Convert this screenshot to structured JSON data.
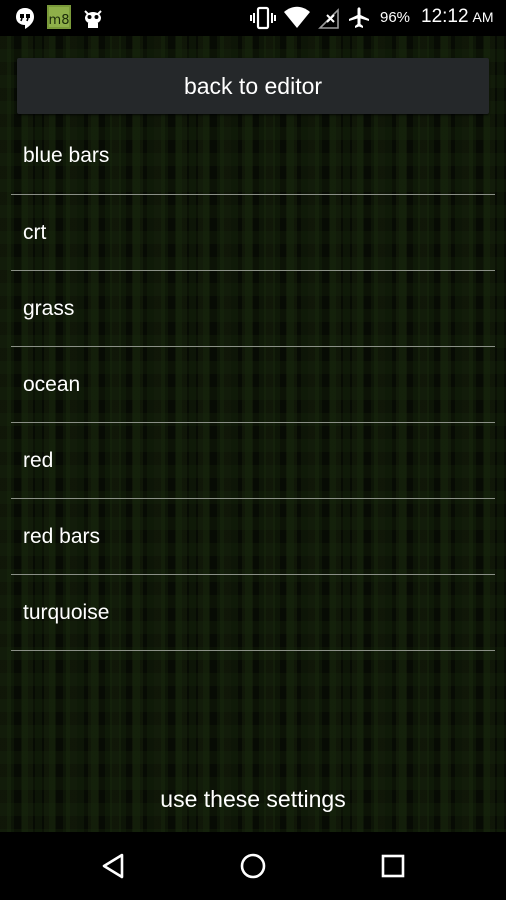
{
  "status_bar": {
    "left_icons": [
      "hangouts-icon",
      "m8-app-icon",
      "android-debug-icon"
    ],
    "right_icons": [
      "vibrate-icon",
      "wifi-icon",
      "no-signal-icon",
      "airplane-icon"
    ],
    "battery_percent": "96%",
    "time": "12:12",
    "ampm": "AM",
    "m8_label": "m8"
  },
  "header": {
    "back_button_label": "back to editor"
  },
  "presets": {
    "items": [
      {
        "label": "blue bars"
      },
      {
        "label": "crt"
      },
      {
        "label": "grass"
      },
      {
        "label": "ocean"
      },
      {
        "label": "red"
      },
      {
        "label": "red bars"
      },
      {
        "label": "turquoise"
      }
    ]
  },
  "footer": {
    "use_settings_label": "use these settings"
  },
  "nav_bar": {
    "buttons": [
      "back-icon",
      "home-icon",
      "recents-icon"
    ]
  },
  "colors": {
    "background_tint": "#0a0f06",
    "button_bg": "#25282a",
    "divider": "#8a8f86",
    "text": "#ffffff"
  }
}
